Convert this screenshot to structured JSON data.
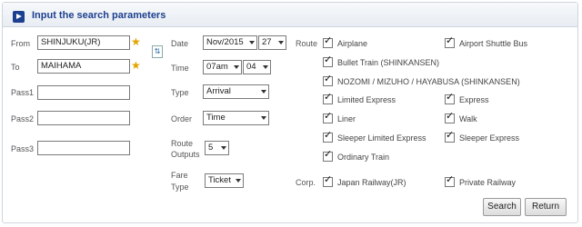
{
  "header": {
    "title": "Input the search parameters"
  },
  "left": {
    "from_label": "From",
    "from_value": "SHINJUKU(JR)",
    "to_label": "To",
    "to_value": "MAIHAMA",
    "pass1_label": "Pass1",
    "pass1_value": "",
    "pass2_label": "Pass2",
    "pass2_value": "",
    "pass3_label": "Pass3",
    "pass3_value": ""
  },
  "middle": {
    "date_label": "Date",
    "date_month": "Nov/2015",
    "date_day": "27",
    "time_label": "Time",
    "time_hour": "07am",
    "time_min": "04",
    "type_label": "Type",
    "type_value": "Arrival",
    "order_label": "Order",
    "order_value": "Time",
    "route_outputs_label1": "Route",
    "route_outputs_label2": "Outputs",
    "route_outputs_value": "5",
    "fare_type_label1": "Fare",
    "fare_type_label2": "Type",
    "fare_type_value": "Ticket"
  },
  "route": {
    "label": "Route",
    "airplane": "Airplane",
    "airport_shuttle_bus": "Airport Shuttle Bus",
    "bullet_train": "Bullet Train (SHINKANSEN)",
    "nozomi": "NOZOMI / MIZUHO / HAYABUSA (SHINKANSEN)",
    "limited_express": "Limited Express",
    "express": "Express",
    "liner": "Liner",
    "walk": "Walk",
    "sleeper_limited_express": "Sleeper Limited Express",
    "sleeper_express": "Sleeper Express",
    "ordinary_train": "Ordinary Train"
  },
  "corp": {
    "label": "Corp.",
    "japan_railway": "Japan Railway(JR)",
    "private_railway": "Private Railway"
  },
  "buttons": {
    "search": "Search",
    "return": "Return"
  },
  "colors": {
    "accent": "#1d3f8f"
  }
}
